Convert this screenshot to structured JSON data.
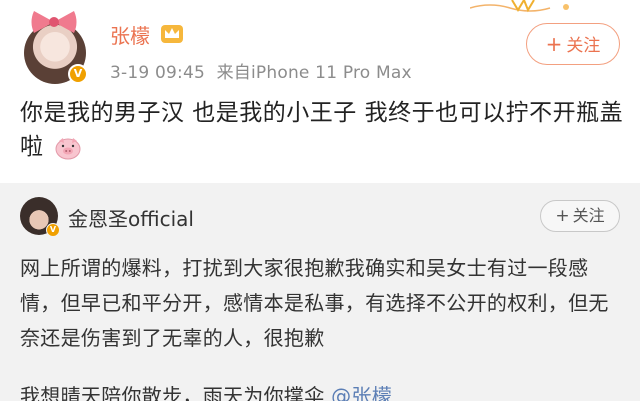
{
  "post": {
    "author": "张檬",
    "time": "3-19 09:45",
    "source": "来自iPhone 11 Pro Max",
    "follow_label": "关注",
    "text": "你是我的男子汉  也是我的小王子  我终于也可以拧不开瓶盖啦",
    "verified": "V",
    "icons": [
      "bow-icon",
      "crown-icon",
      "pig-icon",
      "plus-icon"
    ],
    "colors": {
      "author": "#eb7350",
      "badge": "#f0a000"
    }
  },
  "repost": {
    "author": "金恩圣official",
    "verified": "V",
    "follow_label": "关注",
    "text": "网上所谓的爆料，打扰到大家很抱歉我确实和吴女士有过一段感情，但早已和平分开，感情本是私事，有选择不公开的权利，但无奈还是伤害到了无辜的人，很抱歉",
    "text2": "我想晴天陪你散步，雨天为你撑伞",
    "mention": "@张檬",
    "colors": {
      "background": "#f2f2f2",
      "mention": "#5b7eb5"
    }
  }
}
